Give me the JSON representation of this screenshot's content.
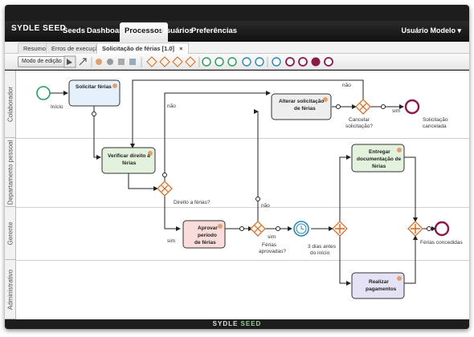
{
  "app": {
    "brand": "SYDLE SEED",
    "footer_brand_a": "SYDLE",
    "footer_brand_b": "SEED"
  },
  "nav": {
    "items": [
      "Seeds",
      "Dashboard",
      "Processos",
      "Usuários",
      "Preferências"
    ],
    "active": "Processos",
    "user": "Usuário Modelo ▾"
  },
  "tabs": [
    "Resumo",
    "Erros de execução",
    "Solicitação de férias [1.0]"
  ],
  "tab_close": "×",
  "toolbar": {
    "edit_mode": "Modo de edição"
  },
  "lanes": [
    "Colaborador",
    "Departamento pessoal",
    "Gerente",
    "Administrativo"
  ],
  "tasks": {
    "solicitar": "Solicitar férias",
    "verificar": [
      "Verificar direito a",
      "férias"
    ],
    "alterar": [
      "Alterar solicitação",
      "de férias"
    ],
    "aprovar": [
      "Aprovar",
      "período",
      "de férias"
    ],
    "entregar": [
      "Entregar",
      "documentação de",
      "férias"
    ],
    "realizar": [
      "Realizar",
      "pagamentos"
    ]
  },
  "events": {
    "inicio": "Início",
    "timer": [
      "3 dias antes",
      "do início"
    ],
    "cancelada": [
      "Solicitação",
      "cancelada"
    ],
    "concedidas": "Férias concedidas"
  },
  "gateways": {
    "direito": "Direito a férias?",
    "aprovadas": [
      "Férias",
      "aprovadas?"
    ],
    "cancelar": [
      "Cancelar",
      "solicitação?"
    ]
  },
  "flow_labels": {
    "nao": "não",
    "sim": "sim"
  }
}
